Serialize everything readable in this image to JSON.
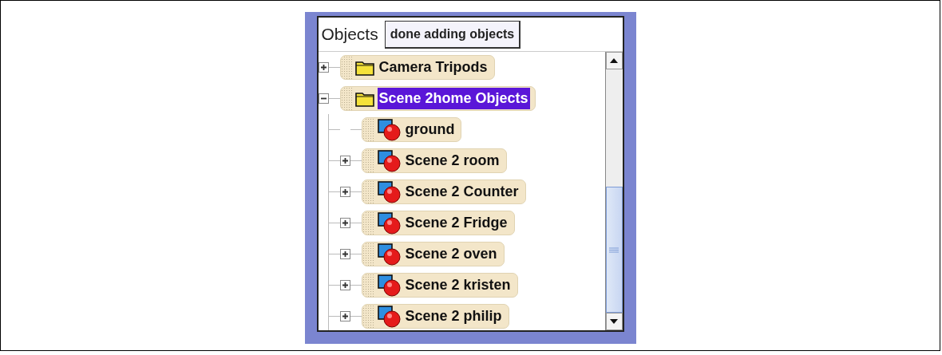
{
  "panel": {
    "title": "Objects",
    "button": "done adding objects"
  },
  "tree": [
    {
      "label": "Camera Tripods",
      "kind": "folder",
      "expandable": true,
      "expanded": false,
      "selected": false
    },
    {
      "label": "Scene 2home Objects",
      "kind": "folder",
      "expandable": true,
      "expanded": true,
      "selected": true,
      "children": [
        {
          "label": "ground",
          "kind": "object",
          "expandable": false,
          "expanded": false,
          "selected": false
        },
        {
          "label": "Scene 2 room",
          "kind": "object",
          "expandable": true,
          "expanded": false,
          "selected": false
        },
        {
          "label": "Scene 2 Counter",
          "kind": "object",
          "expandable": true,
          "expanded": false,
          "selected": false
        },
        {
          "label": "Scene 2 Fridge",
          "kind": "object",
          "expandable": true,
          "expanded": false,
          "selected": false
        },
        {
          "label": "Scene 2 oven",
          "kind": "object",
          "expandable": true,
          "expanded": false,
          "selected": false
        },
        {
          "label": "Scene 2 kristen",
          "kind": "object",
          "expandable": true,
          "expanded": false,
          "selected": false
        },
        {
          "label": "Scene 2 philip",
          "kind": "object",
          "expandable": true,
          "expanded": false,
          "selected": false
        }
      ]
    }
  ]
}
